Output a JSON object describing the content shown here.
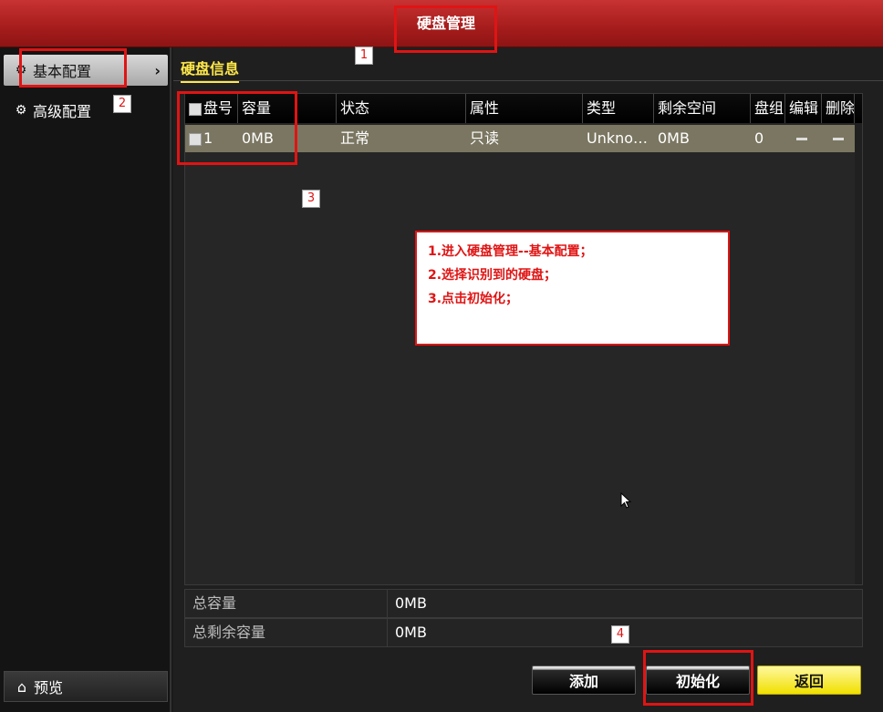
{
  "window": {
    "title": "硬盘管理"
  },
  "sidebar": {
    "items": [
      {
        "label": "基本配置",
        "icon": "gear-icon",
        "active": true
      },
      {
        "label": "高级配置",
        "icon": "gear-icon",
        "active": false
      }
    ],
    "preview_label": "预览",
    "preview_icon": "home-icon"
  },
  "main": {
    "section_tab": "硬盘信息",
    "table": {
      "columns": [
        "盘号",
        "容量",
        "状态",
        "属性",
        "类型",
        "剩余空间",
        "盘组",
        "编辑",
        "删除"
      ],
      "rows": [
        {
          "no": "1",
          "capacity": "0MB",
          "status": "正常",
          "attribute": "只读",
          "type": "Unknow...",
          "free": "0MB",
          "group": "0"
        }
      ]
    },
    "summary": [
      {
        "label": "总容量",
        "value": "0MB"
      },
      {
        "label": "总剩余容量",
        "value": "0MB"
      }
    ],
    "buttons": {
      "add": "添加",
      "init": "初始化",
      "back": "返回"
    }
  },
  "annotations": {
    "badges": [
      "1",
      "2",
      "3",
      "4"
    ],
    "note_lines": [
      "1.进入硬盘管理--基本配置；",
      "2.选择识别到的硬盘；",
      "3.点击初始化；"
    ],
    "box_color": "#e01414"
  },
  "colors": {
    "titlebar": "#a61c1c",
    "tab_accent": "#ffe84a",
    "row_highlight": "#7a7661",
    "back_button": "#f0e000"
  }
}
